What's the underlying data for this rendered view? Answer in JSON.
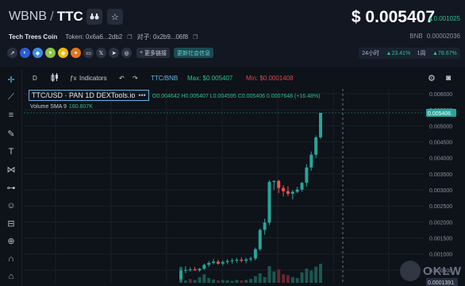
{
  "header": {
    "base_symbol": "WBNB",
    "slash": "/",
    "quote_symbol": "TTC",
    "favorite_icon": "star-outline-icon",
    "binoculars_icon": "binoculars-icon",
    "project_name": "Tech Trees Coin",
    "token_label": "Token: 0x6a6...2db2",
    "pair_label": "对子: 0x2b9...06f8",
    "more_links_label": "更多链接",
    "community_label": "更新社会信息",
    "price": "$ 0.005407",
    "price_change": "▲0.001025",
    "bnb_label": "BNB",
    "bnb_value": "0.00002036",
    "period_24h_label": "24小时",
    "period_24h_value": "23.41%",
    "period_1w_label": "1周",
    "period_1w_value": "78.67%",
    "up_arrow": "▲"
  },
  "social_icons": [
    {
      "name": "share-icon",
      "glyph": "↗",
      "color": "#2a3140"
    },
    {
      "name": "coinmarketcap-icon",
      "glyph": "◐",
      "color": "#2b5bd7"
    },
    {
      "name": "chart-site-icon",
      "glyph": "◆",
      "color": "#3a8ee8"
    },
    {
      "name": "coingecko-icon",
      "glyph": "●",
      "color": "#8bc34a"
    },
    {
      "name": "explorer-icon",
      "glyph": "◉",
      "color": "#f0b90b"
    },
    {
      "name": "metamask-icon",
      "glyph": "✦",
      "color": "#e2761b"
    },
    {
      "name": "website-icon",
      "glyph": "▭",
      "color": "#2a3140"
    },
    {
      "name": "twitter-icon",
      "glyph": "𝕏",
      "color": "#2a3140"
    },
    {
      "name": "telegram-icon",
      "glyph": "➤",
      "color": "#2a3140"
    },
    {
      "name": "discord-icon",
      "glyph": "◎",
      "color": "#2a3140"
    }
  ],
  "toolbar": {
    "interval": "D",
    "indicators_label": "Indicators",
    "pair_label": "TTC/BNB",
    "max_label": "Max: $0.005407",
    "min_label": "Min: $0.0001408"
  },
  "legend": {
    "title": "TTC/USD · PAN  1D  DEXTools.io",
    "dots": "•••",
    "ohlc": "O0.004642 H0.005407 L0.004595 C0.005406 0.0007648 (+16.48%)",
    "volume_label": "Volume SMA 9",
    "volume_value": "160.807K"
  },
  "watermark": {
    "text": "OKLW"
  },
  "colors": {
    "up": "#26a69a",
    "down": "#ef5350",
    "background": "#0e1219",
    "accent": "#5fb6e8"
  },
  "chart_data": {
    "type": "candlestick",
    "y_ticks": [
      "0.006000",
      "0.005500",
      "0.005000",
      "0.004500",
      "0.004000",
      "0.003500",
      "0.003000",
      "0.002500",
      "0.002000",
      "0.001500",
      "0.001000",
      "0.000500"
    ],
    "y_tick_values": [
      0.006,
      0.0055,
      0.005,
      0.0045,
      0.004,
      0.0035,
      0.003,
      0.0025,
      0.002,
      0.0015,
      0.001,
      0.0005
    ],
    "ylim": [
      0.0001,
      0.00615
    ],
    "last_price_label": "0.005406",
    "last_price": 0.005406,
    "low_price_label": "0.0001391",
    "low_price": 0.0001391,
    "candles": [
      {
        "o": 0.00021,
        "h": 0.00055,
        "l": 0.00014,
        "c": 0.00048
      },
      {
        "o": 0.00048,
        "h": 0.00062,
        "l": 0.0004,
        "c": 0.0005
      },
      {
        "o": 0.0005,
        "h": 0.00058,
        "l": 0.00045,
        "c": 0.00052
      },
      {
        "o": 0.00052,
        "h": 0.0006,
        "l": 0.00047,
        "c": 0.00049
      },
      {
        "o": 0.00049,
        "h": 0.00056,
        "l": 0.00044,
        "c": 0.00054
      },
      {
        "o": 0.00054,
        "h": 0.0007,
        "l": 0.0005,
        "c": 0.00066
      },
      {
        "o": 0.00066,
        "h": 0.00078,
        "l": 0.0006,
        "c": 0.00072
      },
      {
        "o": 0.00072,
        "h": 0.00085,
        "l": 0.00068,
        "c": 0.00076
      },
      {
        "o": 0.00076,
        "h": 0.00082,
        "l": 0.00066,
        "c": 0.0007
      },
      {
        "o": 0.0007,
        "h": 0.0008,
        "l": 0.00064,
        "c": 0.00075
      },
      {
        "o": 0.00075,
        "h": 0.00084,
        "l": 0.00068,
        "c": 0.00078
      },
      {
        "o": 0.00078,
        "h": 0.00086,
        "l": 0.0007,
        "c": 0.0008
      },
      {
        "o": 0.0008,
        "h": 0.00088,
        "l": 0.00072,
        "c": 0.00082
      },
      {
        "o": 0.00082,
        "h": 0.0009,
        "l": 0.00074,
        "c": 0.00079
      },
      {
        "o": 0.00079,
        "h": 0.00089,
        "l": 0.00071,
        "c": 0.00083
      },
      {
        "o": 0.00083,
        "h": 0.00092,
        "l": 0.00076,
        "c": 0.00086
      },
      {
        "o": 0.00086,
        "h": 0.0012,
        "l": 0.0008,
        "c": 0.00115
      },
      {
        "o": 0.00115,
        "h": 0.0018,
        "l": 0.0011,
        "c": 0.00175
      },
      {
        "o": 0.00175,
        "h": 0.0021,
        "l": 0.0016,
        "c": 0.00198
      },
      {
        "o": 0.00198,
        "h": 0.0033,
        "l": 0.0019,
        "c": 0.00325
      },
      {
        "o": 0.00325,
        "h": 0.0033,
        "l": 0.003,
        "c": 0.00328
      },
      {
        "o": 0.00328,
        "h": 0.00332,
        "l": 0.0029,
        "c": 0.00306
      },
      {
        "o": 0.00306,
        "h": 0.00315,
        "l": 0.0028,
        "c": 0.00296
      },
      {
        "o": 0.00296,
        "h": 0.00312,
        "l": 0.0028,
        "c": 0.00288
      },
      {
        "o": 0.00288,
        "h": 0.003,
        "l": 0.0027,
        "c": 0.00294
      },
      {
        "o": 0.00294,
        "h": 0.0031,
        "l": 0.0029,
        "c": 0.00301
      },
      {
        "o": 0.00301,
        "h": 0.00325,
        "l": 0.00295,
        "c": 0.00322
      },
      {
        "o": 0.00322,
        "h": 0.0038,
        "l": 0.0031,
        "c": 0.0037
      },
      {
        "o": 0.0037,
        "h": 0.0042,
        "l": 0.0036,
        "c": 0.0041
      },
      {
        "o": 0.0041,
        "h": 0.0047,
        "l": 0.004,
        "c": 0.00464
      },
      {
        "o": 0.00464,
        "h": 0.005407,
        "l": 0.004595,
        "c": 0.005406
      }
    ],
    "volumes": [
      {
        "v": 0.34,
        "up": true
      },
      {
        "v": 0.05,
        "up": true
      },
      {
        "v": 0.08,
        "up": false
      },
      {
        "v": 0.06,
        "up": true
      },
      {
        "v": 0.12,
        "up": true
      },
      {
        "v": 0.18,
        "up": true
      },
      {
        "v": 0.1,
        "up": true
      },
      {
        "v": 0.07,
        "up": true
      },
      {
        "v": 0.05,
        "up": false
      },
      {
        "v": 0.06,
        "up": true
      },
      {
        "v": 0.05,
        "up": true
      },
      {
        "v": 0.04,
        "up": true
      },
      {
        "v": 0.06,
        "up": true
      },
      {
        "v": 0.05,
        "up": false
      },
      {
        "v": 0.06,
        "up": true
      },
      {
        "v": 0.08,
        "up": true
      },
      {
        "v": 0.14,
        "up": true
      },
      {
        "v": 0.2,
        "up": true
      },
      {
        "v": 0.12,
        "up": true
      },
      {
        "v": 0.35,
        "up": true
      },
      {
        "v": 0.24,
        "up": true
      },
      {
        "v": 0.28,
        "up": false
      },
      {
        "v": 0.18,
        "up": false
      },
      {
        "v": 0.16,
        "up": false
      },
      {
        "v": 0.12,
        "up": true
      },
      {
        "v": 0.1,
        "up": true
      },
      {
        "v": 0.22,
        "up": true
      },
      {
        "v": 0.3,
        "up": true
      },
      {
        "v": 0.26,
        "up": true
      },
      {
        "v": 0.34,
        "up": true
      },
      {
        "v": 0.4,
        "up": true
      }
    ]
  }
}
